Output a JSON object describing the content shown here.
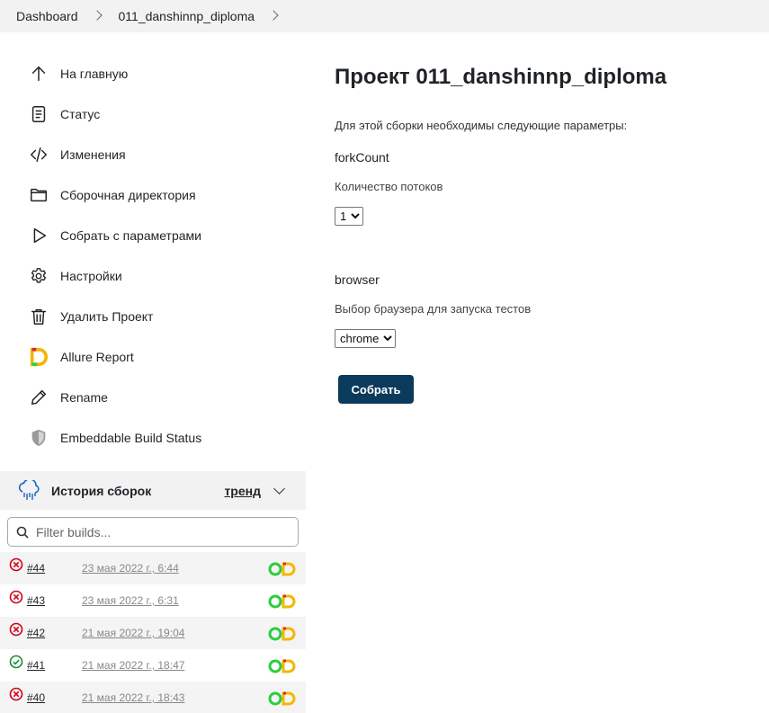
{
  "breadcrumb": {
    "items": [
      "Dashboard",
      "011_danshinnp_diploma"
    ]
  },
  "sidebar": {
    "tasks": [
      {
        "label": "На главную",
        "icon": "arrow-up-icon"
      },
      {
        "label": "Статус",
        "icon": "document-icon"
      },
      {
        "label": "Изменения",
        "icon": "code-icon"
      },
      {
        "label": "Сборочная директория",
        "icon": "folder-icon"
      },
      {
        "label": "Собрать с параметрами",
        "icon": "play-icon"
      },
      {
        "label": "Настройки",
        "icon": "gear-icon"
      },
      {
        "label": "Удалить Проект",
        "icon": "trash-icon"
      },
      {
        "label": "Allure Report",
        "icon": "allure-logo-icon"
      },
      {
        "label": "Rename",
        "icon": "pencil-icon"
      },
      {
        "label": "Embeddable Build Status",
        "icon": "shield-icon"
      }
    ]
  },
  "history": {
    "title": "История сборок",
    "trend_label": "тренд",
    "filter_placeholder": "Filter builds...",
    "builds": [
      {
        "number": "#44",
        "date": "23 мая 2022 г., 6:44",
        "status": "failed"
      },
      {
        "number": "#43",
        "date": "23 мая 2022 г., 6:31",
        "status": "failed"
      },
      {
        "number": "#42",
        "date": "21 мая 2022 г., 19:04",
        "status": "failed"
      },
      {
        "number": "#41",
        "date": "21 мая 2022 г., 18:47",
        "status": "success"
      },
      {
        "number": "#40",
        "date": "21 мая 2022 г., 18:43",
        "status": "failed"
      }
    ]
  },
  "main": {
    "title": "Проект 011_danshinnp_diploma",
    "intro": "Для этой сборки необходимы следующие параметры:",
    "params": [
      {
        "name": "forkCount",
        "description": "Количество потоков",
        "selected": "1"
      },
      {
        "name": "browser",
        "description": "Выбор браузера для запуска тестов",
        "selected": "chrome"
      }
    ],
    "submit_label": "Собрать"
  },
  "colors": {
    "breadcrumb_bg": "#f2f2f2",
    "submit_bg": "#0b3b5c",
    "failed": "#d0021b",
    "success": "#1a8a3a"
  }
}
